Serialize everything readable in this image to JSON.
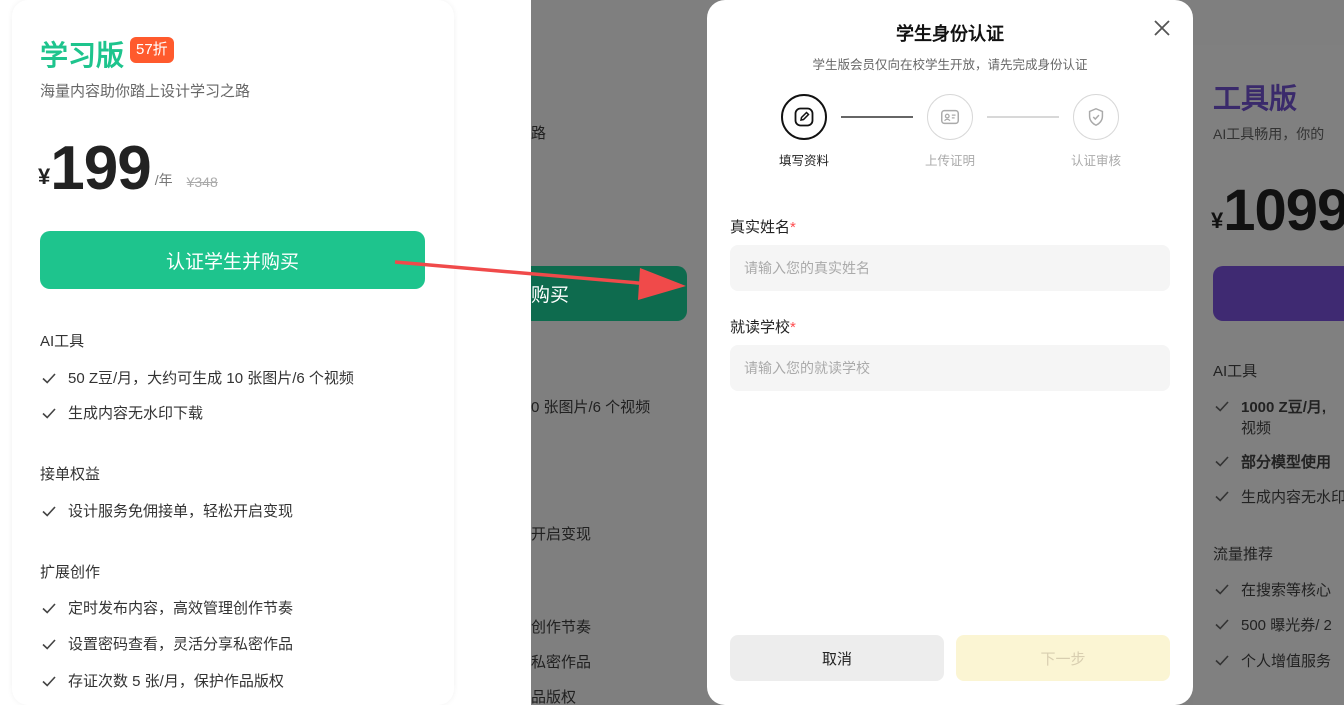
{
  "colors": {
    "green": "#1ec48d",
    "badge": "#ff5a2d",
    "arrow": "#f04a4a",
    "purple": "#3f2a72"
  },
  "study_plan": {
    "name": "学习版",
    "badge": "57折",
    "subtitle": "海量内容助你踏上设计学习之路",
    "currency": "¥",
    "price": "199",
    "per": "/年",
    "original": "¥348",
    "button": "认证学生并购买",
    "sections": [
      {
        "title": "AI工具",
        "items": [
          "50 Z豆/月，大约可生成 10 张图片/6 个视频",
          "生成内容无水印下载"
        ]
      },
      {
        "title": "接单权益",
        "items": [
          "设计服务免佣接单，轻松开启变现"
        ]
      },
      {
        "title": "扩展创作",
        "items": [
          "定时发布内容，高效管理创作节奏",
          "设置密码查看，灵活分享私密作品",
          "存证次数 5 张/月，保护作品版权"
        ]
      }
    ]
  },
  "background_card": {
    "snippets": [
      "路",
      "购买",
      "0 张图片/6 个视频",
      "开启变现",
      "创作节奏",
      "私密作品",
      "品版权"
    ]
  },
  "tools_plan": {
    "name": "工具版",
    "subtitle": "AI工具畅用，你的",
    "currency": "¥",
    "price": "1099",
    "section1": "AI工具",
    "feature1_line1": "1000 Z豆/月,",
    "feature1_line2": "视频",
    "feature2": "部分模型使用",
    "feature3": "生成内容无水印",
    "section2": "流量推荐",
    "feature4": "在搜索等核心",
    "feature5": "500 曝光券/ 2",
    "feature6": "个人增值服务"
  },
  "modal": {
    "title": "学生身份认证",
    "description": "学生版会员仅向在校学生开放，请先完成身份认证",
    "steps": [
      {
        "label": "填写资料",
        "icon": "edit-icon"
      },
      {
        "label": "上传证明",
        "icon": "id-card-icon"
      },
      {
        "label": "认证审核",
        "icon": "shield-check-icon"
      }
    ],
    "fields": {
      "name_label": "真实姓名",
      "name_placeholder": "请输入您的真实姓名",
      "school_label": "就读学校",
      "school_placeholder": "请输入您的就读学校",
      "required_mark": "*"
    },
    "cancel": "取消",
    "next": "下一步"
  }
}
